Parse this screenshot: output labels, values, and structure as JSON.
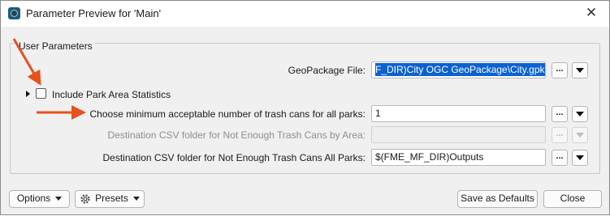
{
  "window": {
    "title": "Parameter Preview for 'Main'",
    "close_glyph": "✕"
  },
  "group": {
    "label": "User Parameters"
  },
  "params": {
    "geopackage_label": "GeoPackage File:",
    "geopackage_value": "F_DIR)City OGC GeoPackage\\City.gpkg\"",
    "park_stats_label": "Include Park Area Statistics",
    "park_stats_checked": false,
    "min_trash_label": "Choose minimum acceptable number of trash cans for all parks:",
    "min_trash_value": "1",
    "dest_by_area_label": "Destination CSV folder for Not Enough Trash Cans by Area:",
    "dest_by_area_value": "",
    "dest_all_label": "Destination CSV folder for Not Enough Trash Cans All Parks:",
    "dest_all_value": "$(FME_MF_DIR)Outputs"
  },
  "buttons": {
    "ellipsis": "...",
    "options": "Options",
    "presets": "Presets",
    "save_defaults": "Save as Defaults",
    "close": "Close"
  },
  "colors": {
    "annotation_arrow": "#e8501c",
    "selection": "#0a62d0"
  },
  "icons": {
    "app": "fme-workbench-icon",
    "expand": "triangle-right-icon",
    "dropdown": "triangle-down-icon",
    "presets": "gear-icon"
  }
}
